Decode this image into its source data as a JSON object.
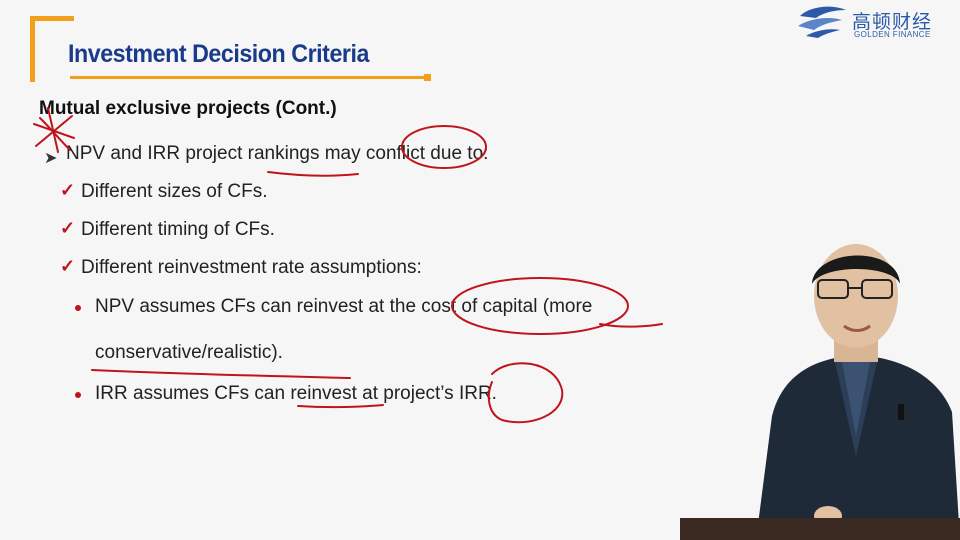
{
  "logo": {
    "cn_text": "高顿财经",
    "en_text": "GOLDEN FINANCE"
  },
  "slide": {
    "title": "Investment Decision Criteria",
    "heading": "Mutual exclusive projects (Cont.)",
    "point": "NPV and IRR project rankings may conflict due to:",
    "reasons": [
      "Different sizes of CFs.",
      "Different timing of CFs.",
      "Different reinvestment rate assumptions:"
    ],
    "bullets": [
      "NPV assumes CFs can reinvest at the cost of capital (more",
      "conservative/realistic).",
      "IRR assumes CFs can reinvest at project’s IRR."
    ]
  },
  "colors": {
    "title_blue": "#1a3a8c",
    "accent_orange": "#f2a01c",
    "ink_red": "#c0141c"
  }
}
